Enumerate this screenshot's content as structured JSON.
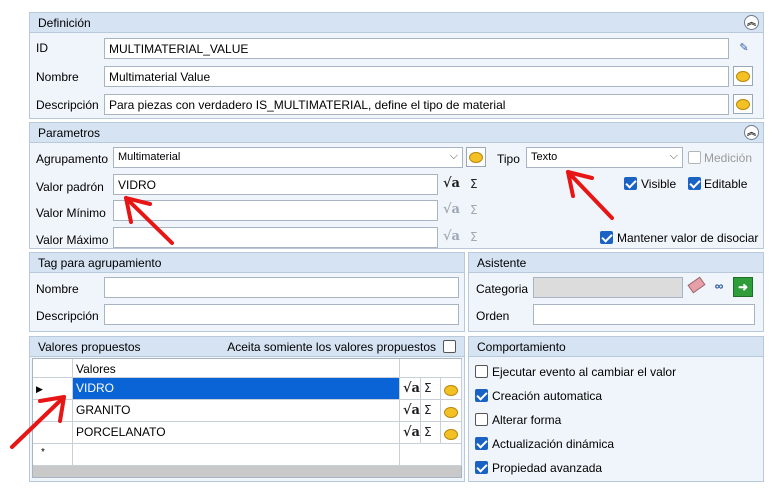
{
  "definicion": {
    "title": "Definición",
    "id_label": "ID",
    "id_value": "MULTIMATERIAL_VALUE",
    "nombre_label": "Nombre",
    "nombre_value": "Multimaterial Value",
    "descripcion_label": "Descripción",
    "descripcion_value": "Para piezas con verdadero IS_MULTIMATERIAL, define el tipo de material"
  },
  "parametros": {
    "title": "Parametros",
    "agrupamento_label": "Agrupamento",
    "agrupamento_value": "Multimaterial",
    "tipo_label": "Tipo",
    "tipo_value": "Texto",
    "medicion_label": "Medición",
    "medicion_checked": false,
    "visible_label": "Visible",
    "visible_checked": true,
    "editable_label": "Editable",
    "editable_checked": true,
    "valor_padron_label": "Valor padrón",
    "valor_padron_value": "VIDRO",
    "valor_minimo_label": "Valor Mínimo",
    "valor_minimo_value": "",
    "valor_maximo_label": "Valor Máximo",
    "valor_maximo_value": "",
    "mantener_label": "Mantener valor de disociar",
    "mantener_checked": true
  },
  "tag": {
    "title": "Tag para agrupamiento",
    "nombre_label": "Nombre",
    "nombre_value": "",
    "descripcion_label": "Descripción",
    "descripcion_value": ""
  },
  "asistente": {
    "title": "Asistente",
    "categoria_label": "Categoria",
    "categoria_value": "",
    "orden_label": "Orden",
    "orden_value": ""
  },
  "valores": {
    "title": "Valores propuestos",
    "only_proposed_label": "Aceita somiente los valores propuestos",
    "only_proposed_checked": false,
    "column_header": "Valores",
    "rows": [
      "VIDRO",
      "GRANITO",
      "PORCELANATO"
    ],
    "new_row_marker": "*"
  },
  "comportamiento": {
    "title": "Comportamiento",
    "items": [
      {
        "label": "Ejecutar evento al cambiar el valor",
        "checked": false
      },
      {
        "label": "Creación automatica",
        "checked": true
      },
      {
        "label": "Alterar forma",
        "checked": false
      },
      {
        "label": "Actualización dinámica",
        "checked": true
      },
      {
        "label": "Propiedad avanzada",
        "checked": true
      }
    ]
  },
  "icons": {
    "collapse": "collapse-up-icon",
    "sqrt": "formula-icon",
    "sigma": "sigma-icon",
    "bubble": "comment-bubble-icon",
    "eraser": "eraser-icon",
    "binoculars": "binoculars-icon",
    "go": "go-arrow-icon"
  },
  "colors": {
    "panel_header": "#d6e3f3",
    "selection": "#0a64d6",
    "annotation_arrow": "#e81515"
  }
}
